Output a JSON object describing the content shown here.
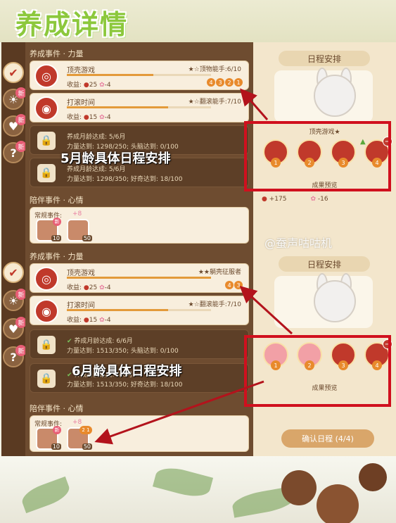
{
  "page_title": "养成详情",
  "watermark": "@蚕声咕咕机",
  "panels": [
    {
      "section_label": "养成事件 · 力量",
      "activities": [
        {
          "name": "顶壳游戏",
          "level": "★☆顶物能手:6/10",
          "earn_label": "收益:",
          "strength": "25",
          "mood": "-4",
          "count_chips": [
            "4",
            "3",
            "2",
            "1"
          ],
          "progress": 0.6
        },
        {
          "name": "打滚时间",
          "level": "★☆翻滚能手:7/10",
          "earn_label": "收益:",
          "strength": "15",
          "mood": "-4",
          "count_chips": [],
          "progress": 0.7
        }
      ],
      "locked": [
        {
          "line1": "养成月龄达成: 5/6月",
          "line2": "力量达到: 1298/250; 头脑达到: 0/100"
        },
        {
          "line1": "养成月龄达成: 5/6月",
          "line2": "力量达到: 1298/350; 好奇达到: 18/100"
        }
      ],
      "overlay_text": "5月龄具体日程安排",
      "companion_label": "陪伴事件 · 心情",
      "companion_tag": "常规事件:",
      "companion_pts": "+8",
      "companion_items": [
        {
          "count": "10",
          "new": "新"
        },
        {
          "count": "50",
          "new": ""
        }
      ],
      "schedule_title": "日程安排",
      "slot_activity": "顶壳游戏★",
      "slots": [
        "1",
        "2",
        "3",
        "4"
      ],
      "preview_label": "成果预览",
      "preview_strength": "+175",
      "preview_mood": "-16",
      "confirm_label": ""
    },
    {
      "section_label": "养成事件 · 力量",
      "activities": [
        {
          "name": "顶壳游戏",
          "level": "★★躺壳征服者",
          "earn_label": "收益:",
          "strength": "25",
          "mood": "-4",
          "count_chips": [
            "4",
            "3"
          ],
          "progress": 1.0
        },
        {
          "name": "打滚时间",
          "level": "★☆翻滚能手:7/10",
          "earn_label": "收益:",
          "strength": "15",
          "mood": "-4",
          "count_chips": [],
          "progress": 0.7
        }
      ],
      "locked": [
        {
          "line1": "养成月龄达成: 6/6月",
          "line2": "力量达到: 1513/350; 头脑达到: 0/100"
        },
        {
          "line1": "养成月龄达成: 6/6月",
          "line2": "力量达到: 1513/350; 好奇达到: 18/100"
        }
      ],
      "overlay_text": "6月龄具体日程安排",
      "companion_label": "陪伴事件 · 心情",
      "companion_tag": "常规事件:",
      "companion_pts": "+8",
      "companion_items": [
        {
          "count": "10",
          "new": "新"
        },
        {
          "count": "50",
          "new": "2 1"
        }
      ],
      "schedule_title": "日程安排",
      "slot_activity": "",
      "slots": [
        "1",
        "2",
        "3",
        "4"
      ],
      "preview_label": "成果预览",
      "preview_strength": "",
      "preview_mood": "",
      "confirm_label": "确认日程 (4/4)"
    }
  ],
  "tab_icons": [
    "check-icon",
    "bulb-icon",
    "heart-icon",
    "question-icon"
  ],
  "new_badge": "新",
  "colors": {
    "accent_red": "#c0392b",
    "highlight": "#d0101e",
    "title_green": "#8cc83c"
  }
}
